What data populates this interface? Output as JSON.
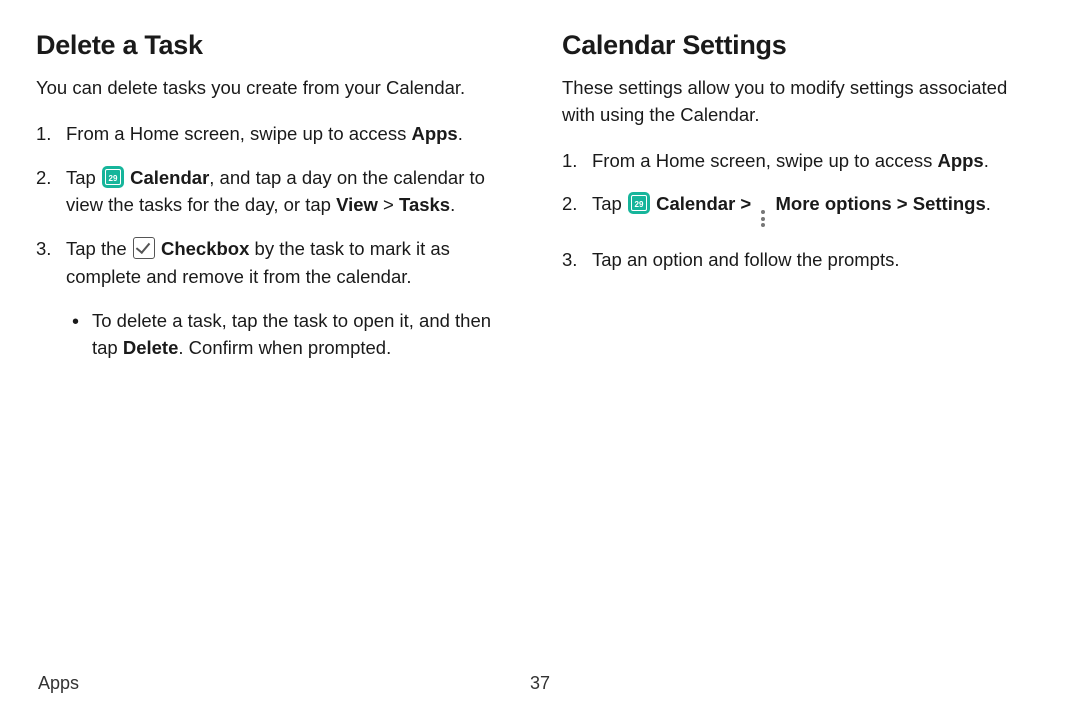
{
  "left": {
    "heading": "Delete a Task",
    "intro": "You can delete tasks you create from your Calendar.",
    "step1_a": "From a Home screen, swipe up to access ",
    "step1_b": "Apps",
    "step1_c": ".",
    "step2_a": "Tap ",
    "step2_b": "Calendar",
    "step2_c": ", and tap a day on the calendar to view the tasks for the day, or tap ",
    "step2_d": "View",
    "step2_e": " > ",
    "step2_f": "Tasks",
    "step2_g": ".",
    "step3_a": "Tap the ",
    "step3_b": "Checkbox",
    "step3_c": " by the task to mark it as complete and remove it from the calendar.",
    "bullet_a": "To delete a task, tap the task to open it, and then tap ",
    "bullet_b": "Delete",
    "bullet_c": ". Confirm when prompted."
  },
  "right": {
    "heading": "Calendar Settings",
    "intro": "These settings allow you to modify settings associated with using the Calendar.",
    "step1_a": "From a Home screen, swipe up to access ",
    "step1_b": "Apps",
    "step1_c": ".",
    "step2_a": "Tap ",
    "step2_b": "Calendar",
    "step2_c": " > ",
    "step2_d": "More options",
    "step2_e": " > ",
    "step2_f": "Settings",
    "step2_g": ".",
    "step3": "Tap an option and follow the prompts."
  },
  "footer": {
    "section": "Apps",
    "page": "37"
  }
}
